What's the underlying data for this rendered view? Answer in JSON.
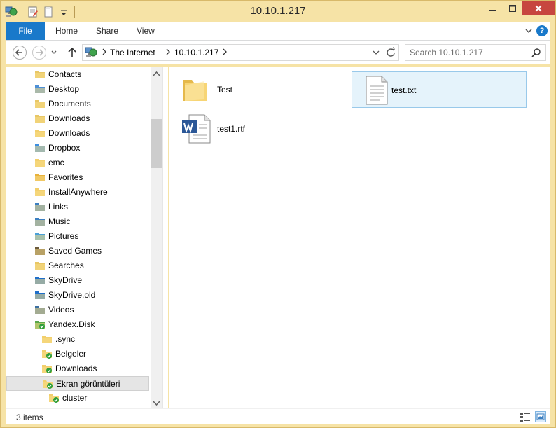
{
  "window": {
    "title": "10.10.1.217"
  },
  "ribbon": {
    "tabs": [
      {
        "label": "File"
      },
      {
        "label": "Home"
      },
      {
        "label": "Share"
      },
      {
        "label": "View"
      }
    ],
    "help_label": "?"
  },
  "address": {
    "crumbs": [
      "The Internet",
      "10.10.1.217"
    ]
  },
  "search": {
    "placeholder": "Search 10.10.1.217"
  },
  "sidebar": {
    "items": [
      {
        "label": "Contacts",
        "icon": "contacts-folder-icon"
      },
      {
        "label": "Desktop",
        "icon": "desktop-folder-icon"
      },
      {
        "label": "Documents",
        "icon": "documents-folder-icon"
      },
      {
        "label": "Downloads",
        "icon": "downloads-folder-icon"
      },
      {
        "label": "Downloads",
        "icon": "folder-icon"
      },
      {
        "label": "Dropbox",
        "icon": "dropbox-folder-icon"
      },
      {
        "label": "emc",
        "icon": "folder-icon"
      },
      {
        "label": "Favorites",
        "icon": "favorites-folder-icon"
      },
      {
        "label": "InstallAnywhere",
        "icon": "folder-icon"
      },
      {
        "label": "Links",
        "icon": "links-folder-icon"
      },
      {
        "label": "Music",
        "icon": "music-folder-icon"
      },
      {
        "label": "Pictures",
        "icon": "pictures-folder-icon"
      },
      {
        "label": "Saved Games",
        "icon": "saved-games-folder-icon"
      },
      {
        "label": "Searches",
        "icon": "searches-folder-icon"
      },
      {
        "label": "SkyDrive",
        "icon": "skydrive-folder-icon"
      },
      {
        "label": "SkyDrive.old",
        "icon": "skydrive-folder-icon"
      },
      {
        "label": "Videos",
        "icon": "videos-folder-icon"
      },
      {
        "label": "Yandex.Disk",
        "icon": "yandex-disk-icon"
      },
      {
        "label": ".sync",
        "icon": "folder-icon"
      },
      {
        "label": "Belgeler",
        "icon": "synced-folder-icon"
      },
      {
        "label": "Downloads",
        "icon": "synced-folder-icon"
      },
      {
        "label": "Ekran görüntüleri",
        "icon": "synced-folder-icon"
      },
      {
        "label": "cluster",
        "icon": "synced-folder-icon"
      }
    ]
  },
  "files": [
    {
      "name": "Test",
      "icon": "folder-icon"
    },
    {
      "name": "test.txt",
      "icon": "text-file-icon"
    },
    {
      "name": "test1.rtf",
      "icon": "word-document-icon"
    }
  ],
  "status": {
    "item_count": "3 items"
  },
  "colors": {
    "frame": "#f6e3a6",
    "accent": "#1979ca",
    "close": "#c7463f",
    "selection_bg": "#e5f3fb",
    "selection_border": "#99c9ea"
  }
}
